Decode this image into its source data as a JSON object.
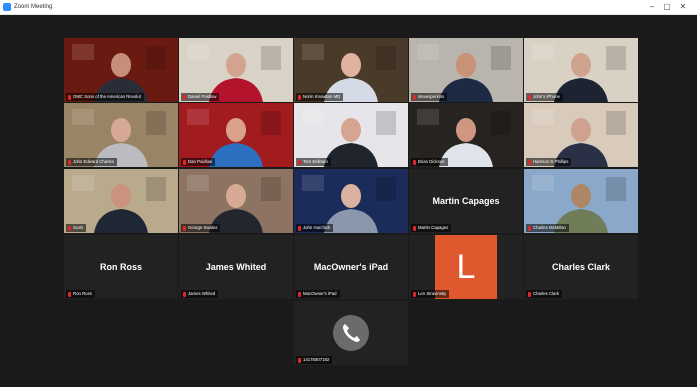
{
  "window": {
    "title": "Zoom Meeting",
    "buttons": {
      "min": "–",
      "max": "▢",
      "close": "✕"
    }
  },
  "tiles": [
    {
      "name": "OMC Sons of the American Revolut",
      "bg": "#6b1a12",
      "shirt": "#2a2d38",
      "skin": "#c58f7c"
    },
    {
      "name": "Daniel Poidlow",
      "bg": "#d9d2c7",
      "shirt": "#b3132d",
      "skin": "#d3a38f"
    },
    {
      "name": "Norm Knowlton MD",
      "bg": "#4a3a2a",
      "shirt": "#d5dbe6",
      "skin": "#e0b2a0"
    },
    {
      "name": "stevesperkins",
      "bg": "#b9b4ad",
      "shirt": "#1e2a44",
      "skin": "#c89277"
    },
    {
      "name": "John's iPhone",
      "bg": "#d8d1c4",
      "shirt": "#1c2433",
      "skin": "#d0a38f"
    },
    {
      "name": "John Edward Charles",
      "bg": "#9a8466",
      "shirt": "#bbbcc2",
      "skin": "#d8a896"
    },
    {
      "name": "Dan Poidlow",
      "bg": "#a21b1f",
      "shirt": "#2d6fc1",
      "skin": "#d9a18a"
    },
    {
      "name": "Tom Sellman",
      "bg": "#e6e6ea",
      "shirt": "#20242c",
      "skin": "#d5a591"
    },
    {
      "name": "Brian Dickson",
      "bg": "#262320",
      "shirt": "#dfe3ea",
      "skin": "#d09780",
      "active": true
    },
    {
      "name": "Harrison D Phillips",
      "bg": "#d8cbbb",
      "shirt": "#2a3046",
      "skin": "#cfa290"
    },
    {
      "name": "Scott",
      "bg": "#b9aa8c",
      "shirt": "#1f2735",
      "skin": "#c99380"
    },
    {
      "name": "George Swales",
      "bg": "#8d7462",
      "shirt": "#23262e",
      "skin": "#d6a994"
    },
    {
      "name": "John Hurchick",
      "bg": "#1b2c5a",
      "shirt": "#8b97ad",
      "skin": "#dcb19f"
    },
    {
      "name": "Martin Capages"
    },
    {
      "name": "Charles McMillan",
      "bg": "#8aa8c9",
      "shirt": "#6f7e58",
      "skin": "#ad8668"
    },
    {
      "name": "Ron Ross"
    },
    {
      "name": "James Whited"
    },
    {
      "name": "MacOwner's iPad"
    },
    {
      "name": "Len Stravinsky",
      "initial": "L"
    },
    {
      "name": "Charles Clark"
    },
    {
      "name": "14175507192"
    }
  ]
}
